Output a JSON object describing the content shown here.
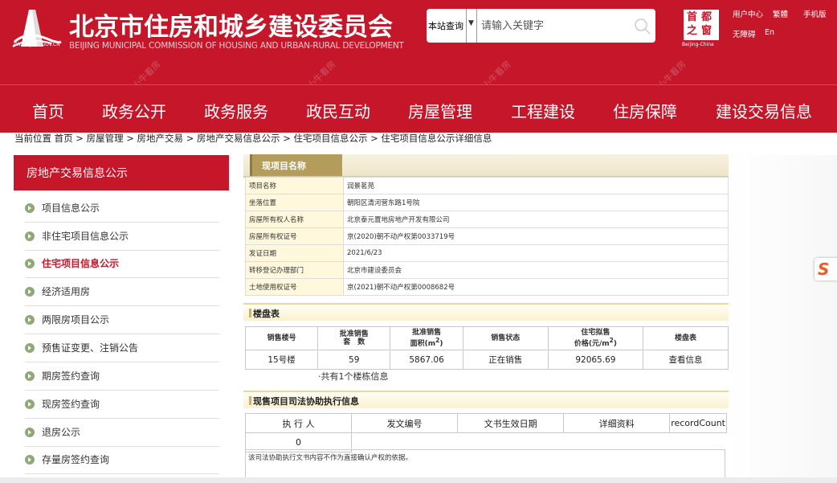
{
  "header": {
    "site_url": "ZW.BEIJING.GOV.CN",
    "title_cn": "北京市住房和城乡建设委员会",
    "title_en": "BEIJING MUNICIPAL COMMISSION OF HOUSING AND URBAN-RURAL DEVELOPMENT",
    "search_scope": "本站查询",
    "search_placeholder": "请输入关键字",
    "capital_text": "首都之窗",
    "capital_en": "Beijing-China",
    "links": [
      "用户中心",
      "繁體",
      "手机版",
      "无障碍",
      "En"
    ]
  },
  "nav": [
    "首页",
    "政务公开",
    "政务服务",
    "政民互动",
    "房屋管理",
    "工程建设",
    "住房保障",
    "建设交易信息"
  ],
  "breadcrumb": "当前位置  首页 > 房屋管理 > 房地产交易 > 房地产交易信息公示 > 住宅项目信息公示 > 住宅项目信息公示详细信息",
  "sidebar": {
    "title": "房地产交易信息公示",
    "items": [
      "项目信息公示",
      "非住宅项目信息公示",
      "住宅项目信息公示",
      "经济适用房",
      "两限房项目公示",
      "预售证变更、注销公告",
      "期房签约查询",
      "现房签约查询",
      "退房公示",
      "存量房签约查询"
    ]
  },
  "project": {
    "tab": "现项目名称",
    "rows": [
      [
        "项目名称",
        "润景茗苑"
      ],
      [
        "坐落位置",
        "朝阳区清河营东路1号院"
      ],
      [
        "房屋所有权人名称",
        "北京泰元置地房地产开发有限公司"
      ],
      [
        "房屋所有权证号",
        "京(2020)朝不动产权第0033719号"
      ],
      [
        "发证日期",
        "2021/6/23"
      ],
      [
        "转移登记办理部门",
        "北京市建设委员会"
      ],
      [
        "土地使用权证号",
        "京(2021)朝不动产权第0008682号"
      ]
    ]
  },
  "buildings": {
    "title": "楼盘表",
    "headers": [
      "销售楼号",
      "批准销售\n套　数",
      "批准销售\n面积(m²)",
      "销售状态",
      "住宅拟售\n价格(元/m²)",
      "楼盘表"
    ],
    "rows": [
      [
        "15号楼",
        "59",
        "5867.06",
        "正在销售",
        "92065.69",
        "查看信息"
      ]
    ],
    "count": "·共有1个楼栋信息"
  },
  "judicial": {
    "title": "现售项目司法协助执行信息",
    "headers": [
      "执 行 人",
      "发文编号",
      "文书生效日期",
      "详细资料",
      "recordCount"
    ],
    "value": "0",
    "note": "该司法协助执行文书内容不作为直接确认产权的依据。"
  },
  "watermark": "小牛看房",
  "float_icon": "S",
  "colors": {
    "brand": "#c5162a",
    "tab": "#b39c5c",
    "label_bg": "#fff8dc"
  }
}
